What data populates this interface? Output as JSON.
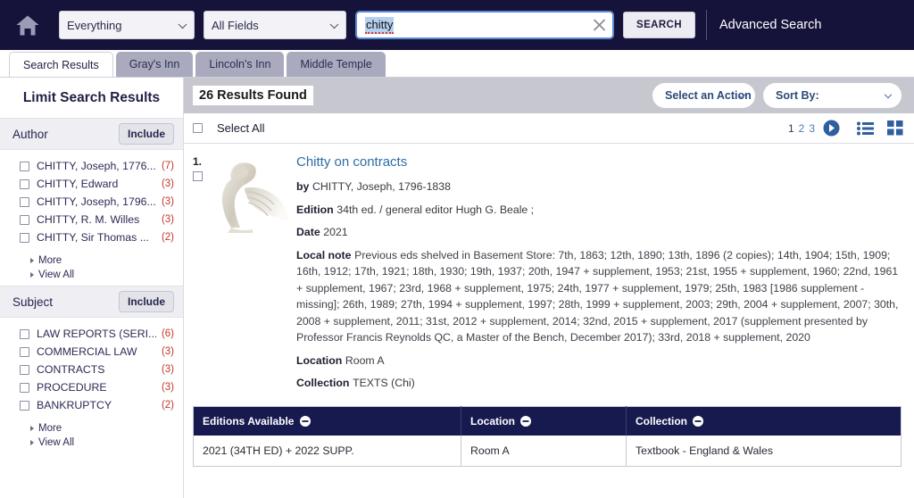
{
  "header": {
    "home_icon": "home-icon",
    "scope_select": {
      "value": "Everything"
    },
    "field_select": {
      "value": "All Fields"
    },
    "search_input": {
      "value": "chitty",
      "placeholder": ""
    },
    "clear_icon": "clear-x-icon",
    "search_button": "SEARCH",
    "advanced_search": "Advanced Search"
  },
  "tabs": [
    {
      "label": "Search Results",
      "active": true
    },
    {
      "label": "Gray's Inn",
      "active": false
    },
    {
      "label": "Lincoln's Inn",
      "active": false
    },
    {
      "label": "Middle Temple",
      "active": false
    }
  ],
  "sidebar": {
    "title": "Limit Search Results",
    "facets": [
      {
        "name": "Author",
        "include_label": "Include",
        "items": [
          {
            "label": "CHITTY, Joseph, 1776...",
            "count": "(7)"
          },
          {
            "label": "CHITTY, Edward",
            "count": "(3)"
          },
          {
            "label": "CHITTY, Joseph, 1796...",
            "count": "(3)"
          },
          {
            "label": "CHITTY, R. M. Willes",
            "count": "(3)"
          },
          {
            "label": "CHITTY, Sir Thomas ...",
            "count": "(2)"
          }
        ],
        "more_label": "More",
        "view_all_label": "View All"
      },
      {
        "name": "Subject",
        "include_label": "Include",
        "items": [
          {
            "label": "LAW REPORTS (SERI...",
            "count": "(6)"
          },
          {
            "label": "COMMERCIAL LAW",
            "count": "(3)"
          },
          {
            "label": "CONTRACTS",
            "count": "(3)"
          },
          {
            "label": "PROCEDURE",
            "count": "(3)"
          },
          {
            "label": "BANKRUPTCY",
            "count": "(2)"
          }
        ],
        "more_label": "More",
        "view_all_label": "View All"
      }
    ]
  },
  "main": {
    "results_found": "26 Results Found",
    "action_select": {
      "value": "Select an Action"
    },
    "sort_select": {
      "value": "Sort By:"
    },
    "select_all_label": "Select All",
    "pagination": {
      "pages": [
        "1",
        "2",
        "3"
      ],
      "current": "1",
      "next_icon": "next-arrow-icon"
    },
    "view_list_icon": "list-view-icon",
    "view_grid_icon": "grid-view-icon",
    "record": {
      "number": "1.",
      "thumbnail": "pegasus-thumbnail",
      "title": "Chitty on contracts",
      "fields": [
        {
          "label": "by",
          "value": "CHITTY, Joseph, 1796-1838"
        },
        {
          "label": "Edition",
          "value": "34th ed. / general editor Hugh G. Beale ;"
        },
        {
          "label": "Date",
          "value": "2021"
        },
        {
          "label": "Local note",
          "value": "Previous eds shelved in Basement Store: 7th, 1863; 12th, 1890; 13th, 1896 (2 copies); 14th, 1904; 15th, 1909; 16th, 1912; 17th, 1921; 18th, 1930; 19th, 1937; 20th, 1947 + supplement, 1953; 21st, 1955 + supplement, 1960; 22nd, 1961 + supplement, 1967; 23rd, 1968 + supplement, 1975; 24th, 1977 + supplement, 1979; 25th, 1983 [1986 supplement - missing]; 26th, 1989; 27th, 1994 + supplement, 1997; 28th, 1999 + supplement, 2003; 29th, 2004 + supplement, 2007; 30th, 2008 + supplement, 2011; 31st, 2012 + supplement, 2014; 32nd, 2015 + supplement, 2017 (supplement presented by Professor Francis Reynolds QC, a Master of the Bench, December 2017); 33rd, 2018 + supplement, 2020"
        },
        {
          "label": "Location",
          "value": "Room A"
        },
        {
          "label": "Collection",
          "value": "TEXTS (Chi)"
        }
      ]
    },
    "editions_table": {
      "columns": [
        "Editions Available",
        "Location",
        "Collection"
      ],
      "rows": [
        [
          "2021 (34TH ED) + 2022 SUPP.",
          "Room A",
          "Textbook - England & Wales"
        ]
      ]
    }
  },
  "colors": {
    "header_bg": "#15133a",
    "table_header_bg": "#171a4e",
    "link_blue": "#2d6da4",
    "count_red": "#c0392b",
    "toolbar_grey": "#c7c7cf"
  }
}
